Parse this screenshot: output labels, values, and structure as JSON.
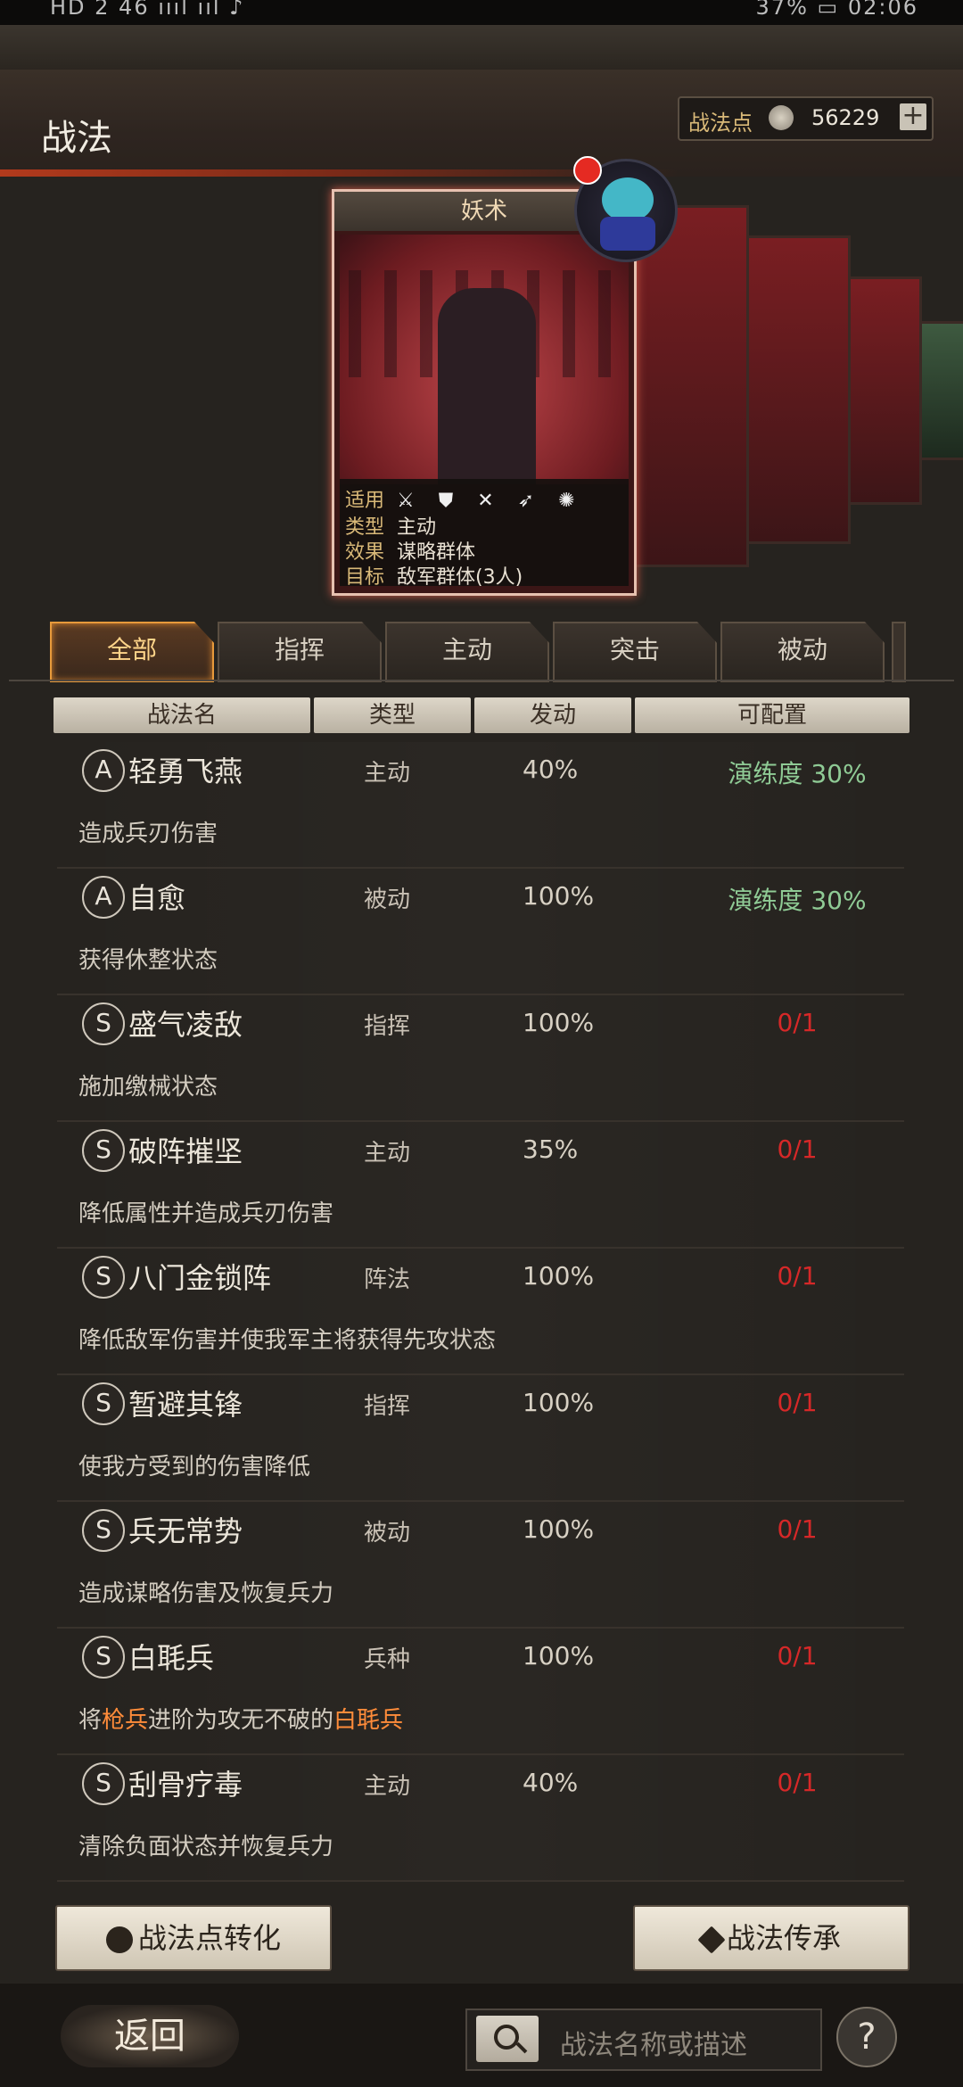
{
  "header": {
    "title": "战法",
    "points_label": "战法点",
    "points_value": "56229",
    "plus": "+"
  },
  "card": {
    "name": "妖术",
    "applicable_label": "适用",
    "applicable_icons": "⚔ ⛊ ✕ ➶ ✺",
    "type_label": "类型",
    "type_value": "主动",
    "effect_label": "效果",
    "effect_value": "谋略群体",
    "target_label": "目标",
    "target_value": "敌军群体(3人)"
  },
  "tabs": [
    "全部",
    "指挥",
    "主动",
    "突击",
    "被动"
  ],
  "columns": [
    "战法名",
    "类型",
    "发动",
    "可配置"
  ],
  "rows": [
    {
      "grade": "A",
      "name": "轻勇飞燕",
      "type": "主动",
      "rate": "40%",
      "cfg": "演练度 30%",
      "desc": "造成兵刃伤害"
    },
    {
      "grade": "A",
      "name": "自愈",
      "type": "被动",
      "rate": "100%",
      "cfg": "演练度 30%",
      "desc": "获得休整状态"
    },
    {
      "grade": "S",
      "name": "盛气凌敌",
      "type": "指挥",
      "rate": "100%",
      "cfg": "0/1",
      "desc": "施加缴械状态"
    },
    {
      "grade": "S",
      "name": "破阵摧坚",
      "type": "主动",
      "rate": "35%",
      "cfg": "0/1",
      "desc": "降低属性并造成兵刃伤害"
    },
    {
      "grade": "S",
      "name": "八门金锁阵",
      "type": "阵法",
      "rate": "100%",
      "cfg": "0/1",
      "desc": "降低敌军伤害并使我军主将获得先攻状态"
    },
    {
      "grade": "S",
      "name": "暂避其锋",
      "type": "指挥",
      "rate": "100%",
      "cfg": "0/1",
      "desc": "使我方受到的伤害降低"
    },
    {
      "grade": "S",
      "name": "兵无常势",
      "type": "被动",
      "rate": "100%",
      "cfg": "0/1",
      "desc": "造成谋略伤害及恢复兵力"
    },
    {
      "grade": "S",
      "name": "白毦兵",
      "type": "兵种",
      "rate": "100%",
      "cfg": "0/1",
      "desc_parts": [
        "将",
        "枪兵",
        "进阶为攻无不破的",
        "白毦兵"
      ]
    },
    {
      "grade": "S",
      "name": "刮骨疗毒",
      "type": "主动",
      "rate": "40%",
      "cfg": "0/1",
      "desc": "清除负面状态并恢复兵力"
    }
  ],
  "buttons": {
    "convert": "战法点转化",
    "inherit": "战法传承",
    "back": "返回",
    "help": "?"
  },
  "search": {
    "placeholder": "战法名称或描述"
  },
  "status": {
    "left": "HD 2 46 ıııl ııl ♪",
    "right": "37% ▭ 02:06"
  },
  "colors": {
    "accent": "#e79a3b",
    "green": "#8fcb95",
    "red": "#d62828",
    "highlight": "#ff8c3a"
  }
}
